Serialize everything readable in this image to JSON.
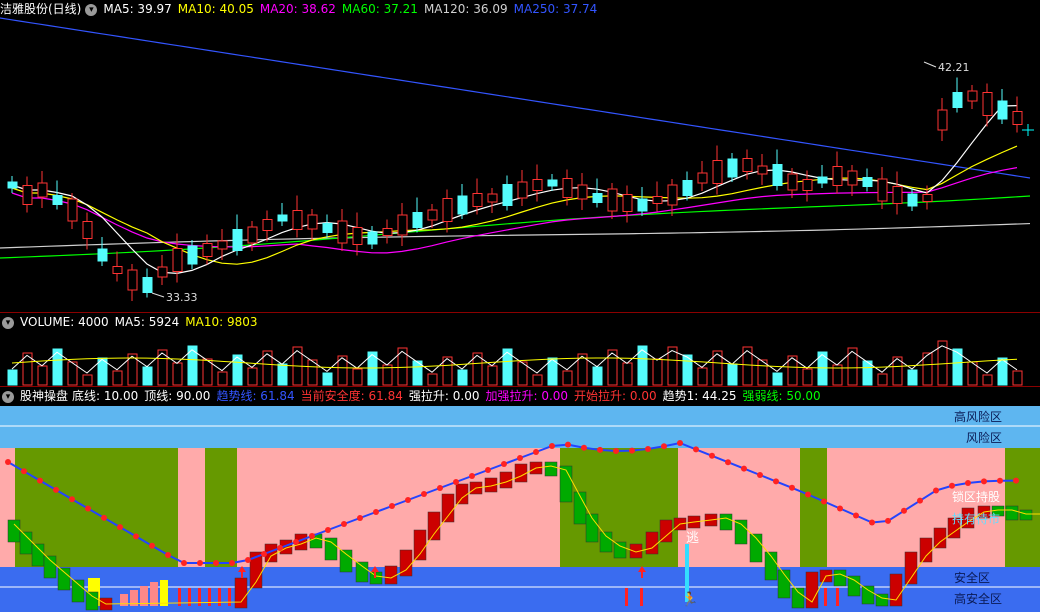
{
  "main_panel": {
    "stock_name": "洁雅股份(日线)",
    "ma": [
      {
        "label": "MA5: 39.97",
        "color": "#ffffff"
      },
      {
        "label": "MA10: 40.05",
        "color": "#ffff00"
      },
      {
        "label": "MA20: 38.62",
        "color": "#ff00ff"
      },
      {
        "label": "MA60: 37.21",
        "color": "#00ff00"
      },
      {
        "label": "MA120: 36.09",
        "color": "#d0d0d0"
      },
      {
        "label": "MA250: 37.74",
        "color": "#3355ff"
      }
    ],
    "high_label": "42.21",
    "low_label": "33.33"
  },
  "volume_panel": {
    "labels": [
      {
        "label": "VOLUME: 4000",
        "color": "#ffffff"
      },
      {
        "label": "MA5: 5924",
        "color": "#ffffff"
      },
      {
        "label": "MA10: 9803",
        "color": "#ffff00"
      }
    ]
  },
  "indicator_panel": {
    "name": "股神操盘",
    "labels": [
      {
        "label": "底线: 10.00",
        "color": "#ffffff"
      },
      {
        "label": "顶线: 90.00",
        "color": "#ffffff"
      },
      {
        "label": "趋势线: 61.84",
        "color": "#3355ff"
      },
      {
        "label": "当前安全度: 61.84",
        "color": "#ff3333"
      },
      {
        "label": "强拉升: 0.00",
        "color": "#ffffff"
      },
      {
        "label": "加强拉升: 0.00",
        "color": "#ff00ff"
      },
      {
        "label": "开始拉升: 0.00",
        "color": "#ff3333"
      },
      {
        "label": "趋势1: 44.25",
        "color": "#ffffff"
      },
      {
        "label": "强弱线: 50.00",
        "color": "#00ff00"
      }
    ],
    "zones": {
      "high_risk": "高风险区",
      "risk": "风险区",
      "safe": "安全区",
      "high_safe": "高安全区"
    },
    "annotations": {
      "escape": "逃",
      "hold": "锁区持股",
      "hold2": "持有待市"
    }
  }
}
